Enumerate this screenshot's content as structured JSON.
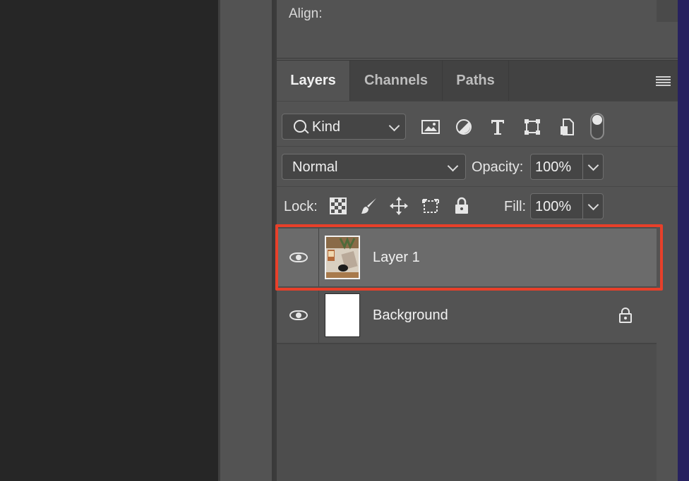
{
  "properties": {
    "align_label": "Align:"
  },
  "tabs": [
    {
      "label": "Layers",
      "active": true
    },
    {
      "label": "Channels",
      "active": false
    },
    {
      "label": "Paths",
      "active": false
    }
  ],
  "filter": {
    "kind_label": "Kind",
    "icons": [
      "image-filter-icon",
      "adjustment-filter-icon",
      "type-filter-icon",
      "shape-filter-icon",
      "smart-object-filter-icon"
    ]
  },
  "blend": {
    "mode": "Normal",
    "opacity_label": "Opacity:",
    "opacity_value": "100%"
  },
  "lock": {
    "label": "Lock:",
    "icons": [
      "lock-transparent-pixels-icon",
      "lock-image-pixels-icon",
      "lock-position-icon",
      "lock-artboard-icon",
      "lock-all-icon"
    ],
    "fill_label": "Fill:",
    "fill_value": "100%"
  },
  "layers": [
    {
      "name": "Layer 1",
      "visible": true,
      "selected": true,
      "locked": false
    },
    {
      "name": "Background",
      "visible": true,
      "selected": false,
      "locked": true
    }
  ],
  "colors": {
    "panel": "#535353",
    "selected_row": "#6b6b6b",
    "highlight": "#e8402a"
  }
}
